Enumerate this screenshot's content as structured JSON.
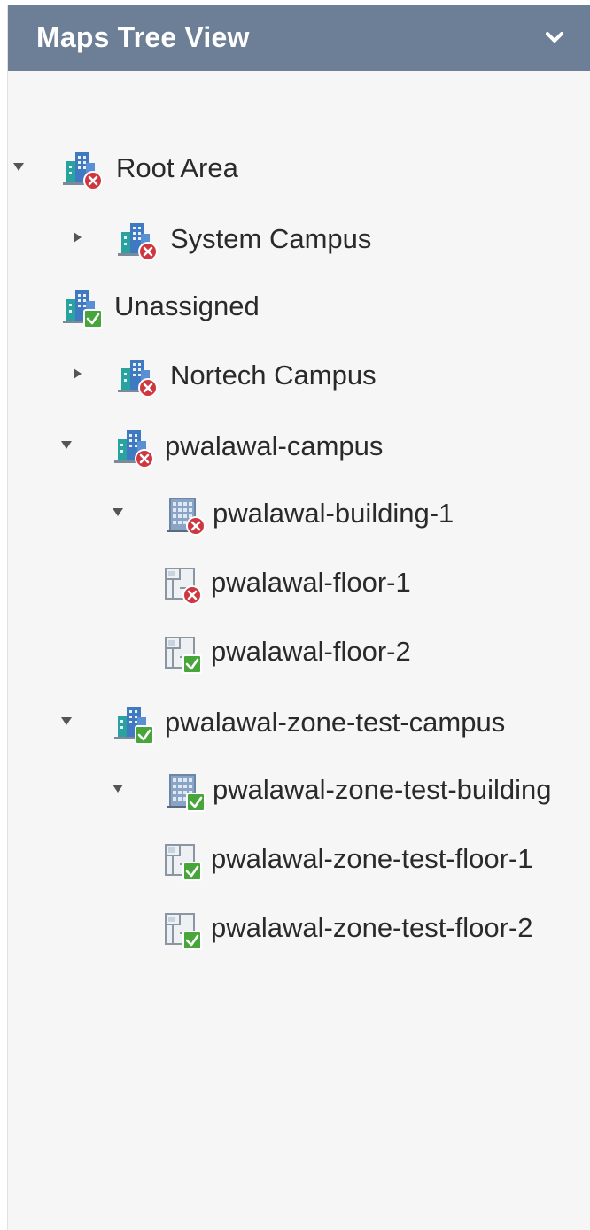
{
  "panel": {
    "title": "Maps Tree View",
    "header_icon": "chevron-down-icon"
  },
  "tree": [
    {
      "label": "Root Area",
      "type": "area",
      "status": "error",
      "expander": "expanded"
    },
    {
      "label": "System Campus",
      "type": "area",
      "status": "error",
      "expander": "collapsed"
    },
    {
      "label": "Unassigned",
      "type": "area",
      "status": "ok",
      "expander": "none"
    },
    {
      "label": "Nortech Campus",
      "type": "area",
      "status": "error",
      "expander": "collapsed"
    },
    {
      "label": "pwalawal-campus",
      "type": "area",
      "status": "error",
      "expander": "expanded"
    },
    {
      "label": "pwalawal-building-1",
      "type": "building",
      "status": "error",
      "expander": "expanded"
    },
    {
      "label": "pwalawal-floor-1",
      "type": "floor",
      "status": "error",
      "expander": "none"
    },
    {
      "label": "pwalawal-floor-2",
      "type": "floor",
      "status": "ok",
      "expander": "none"
    },
    {
      "label": "pwalawal-zone-test-campus",
      "type": "area",
      "status": "ok",
      "expander": "expanded"
    },
    {
      "label": "pwalawal-zone-test-building",
      "type": "building",
      "status": "ok",
      "expander": "expanded"
    },
    {
      "label": "pwalawal-zone-test-floor-1",
      "type": "floor",
      "status": "ok",
      "expander": "none"
    },
    {
      "label": "pwalawal-zone-test-floor-2",
      "type": "floor",
      "status": "ok",
      "expander": "none"
    }
  ],
  "colors": {
    "header_bg": "#6c7f96",
    "panel_bg": "#f6f6f6",
    "status_error": "#d0363f",
    "status_ok": "#47a63a",
    "icon_blue": "#3f79c2",
    "icon_teal": "#2aa3a0",
    "caret": "#555555"
  }
}
